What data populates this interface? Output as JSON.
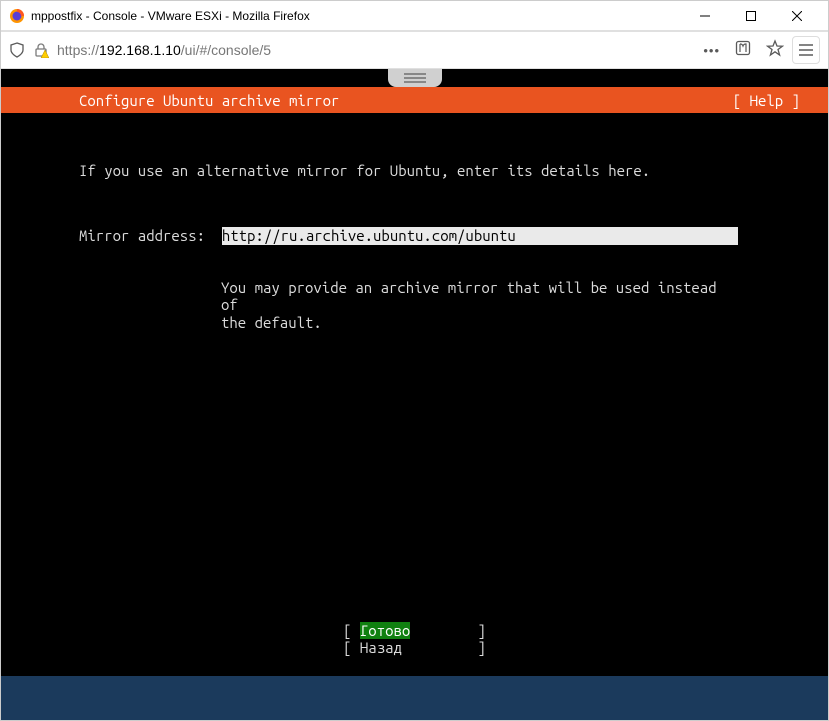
{
  "window": {
    "title": "mppostfix - Console - VMware ESXi - Mozilla Firefox"
  },
  "address": {
    "prefix": "https://",
    "host": "192.168.1.10",
    "path": "/ui/#/console/5",
    "ellipsis": "•••"
  },
  "header": {
    "title": "Configure Ubuntu archive mirror",
    "help": "[ Help ]"
  },
  "body": {
    "intro": "If you use an alternative mirror for Ubuntu, enter its details here.",
    "mirror_label": "Mirror address:  ",
    "mirror_value": "http://ru.archive.ubuntu.com/ubuntu",
    "mirror_help": "You may provide an archive mirror that will be used instead of\nthe default."
  },
  "buttons": {
    "done_open": "[ ",
    "done_label": "Готово",
    "done_close": "        ]",
    "back_open": "[ ",
    "back_label": "Назад",
    "back_close": "         ]"
  }
}
